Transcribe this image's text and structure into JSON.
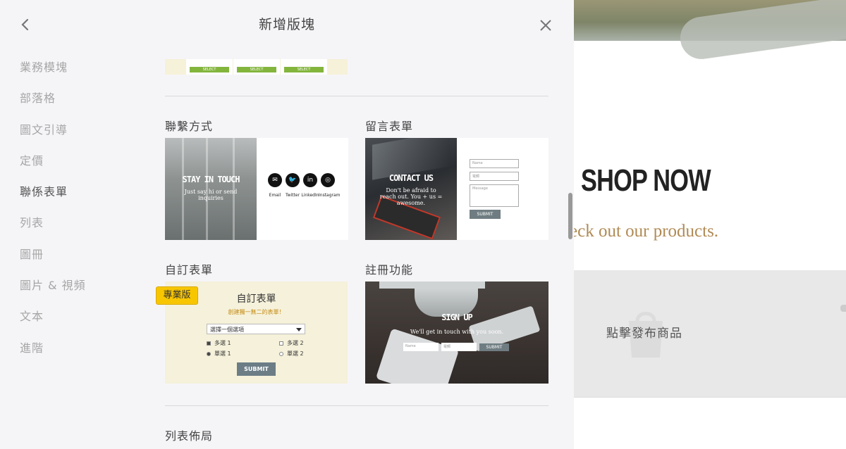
{
  "header": {
    "title": "新增版塊"
  },
  "nav": {
    "items": [
      {
        "label": "業務模塊"
      },
      {
        "label": "部落格"
      },
      {
        "label": "圖文引導"
      },
      {
        "label": "定價"
      },
      {
        "label": "聯係表單",
        "active": true
      },
      {
        "label": "列表"
      },
      {
        "label": "圖冊"
      },
      {
        "label": "圖片 & 視頻"
      },
      {
        "label": "文本"
      },
      {
        "label": "進階"
      }
    ]
  },
  "top_strip": {
    "button_label": "SELECT"
  },
  "sections": {
    "contact": {
      "label": "聯繫方式",
      "thumb_title": "STAY IN TOUCH",
      "thumb_sub": "Just say hi or send inquiries",
      "icons": [
        {
          "icon": "email-icon",
          "glyph": "✉",
          "label": "Email"
        },
        {
          "icon": "twitter-icon",
          "glyph": "🐦",
          "label": "Twitter"
        },
        {
          "icon": "linkedin-icon",
          "glyph": "in",
          "label": "LinkedIn"
        },
        {
          "icon": "instagram-icon",
          "glyph": "◎",
          "label": "Instagram"
        }
      ]
    },
    "message": {
      "label": "留言表單",
      "thumb_title": "CONTACT US",
      "thumb_sub": "Don't be afraid to reach out. You + us = awesome.",
      "field_name": "Name",
      "field_email": "電郵",
      "field_message": "Message",
      "submit": "SUBMIT"
    },
    "custom": {
      "label": "自訂表單",
      "pro_badge": "專業版",
      "thumb_title": "自訂表單",
      "thumb_sub": "創建獨一無二的表單！",
      "select_placeholder": "選擇一個選項",
      "options": [
        "多選 1",
        "多選 2",
        "單選 1",
        "單選 2"
      ],
      "submit": "SUBMIT"
    },
    "signup": {
      "label": "註冊功能",
      "thumb_title": "SIGN UP",
      "thumb_sub": "We'll get in touch with you soon.",
      "field_name": "Name",
      "field_email": "電郵",
      "submit": "SUBMIT"
    },
    "list_layout": {
      "label": "列表佈局"
    }
  },
  "preview": {
    "headline": "SHOP NOW",
    "tagline": "eck out our products.",
    "product_prompt": "點擊發布商品"
  }
}
